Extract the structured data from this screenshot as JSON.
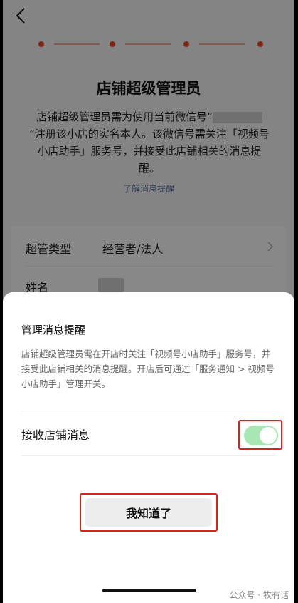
{
  "page": {
    "title": "店铺超级管理员",
    "desc_prefix": "店铺超级管理员需为使用当前微信号“",
    "desc_suffix": "”注册该小店的实名本人。该微信号需关注「视频号小店助手」服务号，并接受此店铺相关的消息提醒。",
    "learn_link": "了解消息提醒"
  },
  "form": {
    "rows": [
      {
        "label": "超管类型",
        "value": "经营者/法人"
      },
      {
        "label": "姓名",
        "value": ""
      }
    ]
  },
  "sheet": {
    "title": "管理消息提醒",
    "desc": "店铺超级管理员需在开店时关注「视频号小店助手」服务号，并接受此店铺相关的消息提醒。开店后可通过「服务通知 > 视频号小店助手」管理开关。",
    "toggle_label": "接收店铺消息",
    "toggle_on": true,
    "confirm_label": "我知道了"
  },
  "watermark": "公众号 · 牧有话",
  "colors": {
    "accent": "#e04a2a",
    "toggle_on": "#a8e6b4",
    "link": "#576b95",
    "highlight": "#e02020"
  }
}
